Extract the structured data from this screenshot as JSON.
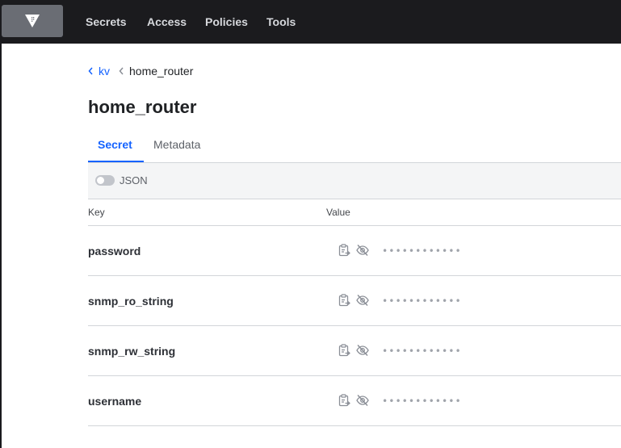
{
  "nav": {
    "logo_icon": "vault-logo-icon",
    "links": [
      "Secrets",
      "Access",
      "Policies",
      "Tools"
    ]
  },
  "breadcrumb": {
    "parent": "kv",
    "current": "home_router"
  },
  "page": {
    "title": "home_router"
  },
  "tabs": [
    "Secret",
    "Metadata"
  ],
  "toolbar": {
    "json_toggle_label": "JSON",
    "json_toggle_on": false
  },
  "table": {
    "columns": [
      "Key",
      "Value"
    ],
    "rows": [
      {
        "key": "password",
        "masked_value": "••••••••••••"
      },
      {
        "key": "snmp_ro_string",
        "masked_value": "••••••••••••"
      },
      {
        "key": "snmp_rw_string",
        "masked_value": "••••••••••••"
      },
      {
        "key": "username",
        "masked_value": "••••••••••••"
      }
    ],
    "row_icons": [
      "clipboard-copy-icon",
      "eye-off-icon"
    ]
  },
  "colors": {
    "nav_bg": "#1b1b1e",
    "accent": "#1563ff",
    "toolbar_bg": "#f4f5f6"
  }
}
